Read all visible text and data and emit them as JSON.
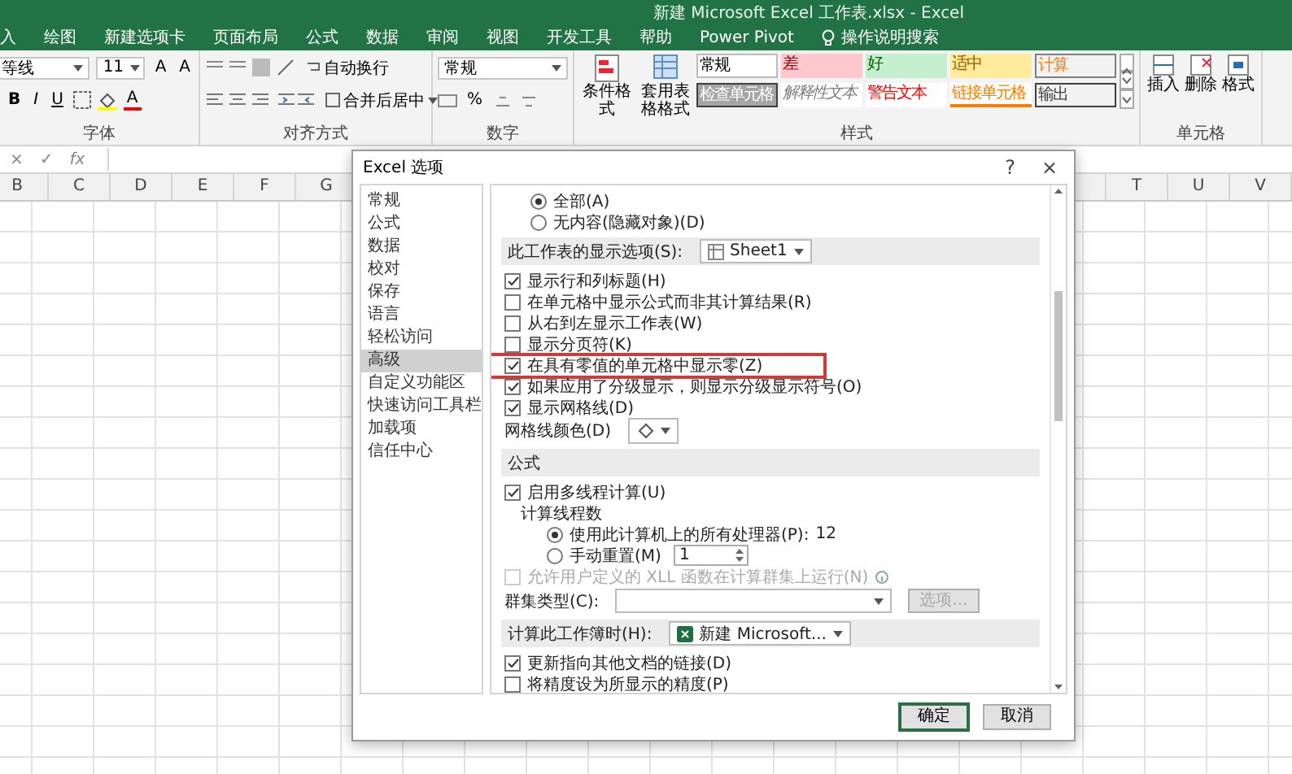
{
  "window": {
    "title": "新建 Microsoft Excel 工作表.xlsx  -  Excel"
  },
  "tabs": [
    {
      "label": "入"
    },
    {
      "label": "绘图"
    },
    {
      "label": "新建选项卡"
    },
    {
      "label": "页面布局"
    },
    {
      "label": "公式"
    },
    {
      "label": "数据"
    },
    {
      "label": "审阅"
    },
    {
      "label": "视图"
    },
    {
      "label": "开发工具"
    },
    {
      "label": "帮助"
    },
    {
      "label": "Power Pivot"
    }
  ],
  "tell_me": {
    "placeholder": "操作说明搜索"
  },
  "ribbon": {
    "font_group": {
      "label": "字体",
      "font": "等线",
      "size": "11",
      "size_buttons": [
        "A",
        "A"
      ],
      "format_buttons": [
        "B",
        "I",
        "U"
      ],
      "font_color_button": "A"
    },
    "alignment_group": {
      "label": "对齐方式",
      "wrap": "自动换行",
      "merge": "合并后居中"
    },
    "number_group": {
      "label": "数字",
      "format": "常规",
      "percent": "%"
    },
    "style_group": {
      "label": "样式",
      "conditional": "条件格式",
      "table": "套用表格格式",
      "styles": [
        {
          "label": "常规",
          "kind": "normal"
        },
        {
          "label": "差",
          "kind": "bad"
        },
        {
          "label": "好",
          "kind": "good"
        },
        {
          "label": "适中",
          "kind": "neutral"
        },
        {
          "label": "计算",
          "kind": "calculation"
        },
        {
          "label": "检查单元格",
          "kind": "check"
        },
        {
          "label": "解释性文本",
          "kind": "explanatory"
        },
        {
          "label": "警告文本",
          "kind": "warning"
        },
        {
          "label": "链接单元格",
          "kind": "linked"
        },
        {
          "label": "输出",
          "kind": "output"
        }
      ]
    },
    "cells_group": {
      "label": "单元格",
      "buttons": [
        "插入",
        "删除",
        "格式"
      ]
    }
  },
  "formula_bar": {
    "cancel": "×",
    "enter": "✓",
    "function": "fx"
  },
  "columns": [
    "B",
    "C",
    "D",
    "E",
    "F",
    "G",
    "T",
    "U",
    "V"
  ],
  "dialog": {
    "title": "Excel 选项",
    "help": "?",
    "close": "×",
    "sidebar": [
      {
        "label": "常规",
        "selected": false
      },
      {
        "label": "公式",
        "selected": false
      },
      {
        "label": "数据",
        "selected": false
      },
      {
        "label": "校对",
        "selected": false
      },
      {
        "label": "保存",
        "selected": false
      },
      {
        "label": "语言",
        "selected": false
      },
      {
        "label": "轻松访问",
        "selected": false
      },
      {
        "label": "高级",
        "selected": true
      },
      {
        "label": "自定义功能区",
        "selected": false
      },
      {
        "label": "快速访问工具栏",
        "selected": false
      },
      {
        "label": "加载项",
        "selected": false
      },
      {
        "label": "信任中心",
        "selected": false
      }
    ],
    "options": [
      {
        "kind": "radio",
        "label": "全部(A)",
        "selected": true
      },
      {
        "kind": "radio",
        "label": "无内容(隐藏对象)(D)",
        "selected": false
      },
      {
        "kind": "section",
        "label": "此工作表的显示选项(S):",
        "dropdown": "Sheet1"
      },
      {
        "kind": "checkbox",
        "label": "显示行和列标题(H)",
        "checked": true,
        "disabled": false
      },
      {
        "kind": "checkbox",
        "label": "在单元格中显示公式而非其计算结果(R)",
        "checked": false,
        "disabled": false
      },
      {
        "kind": "checkbox",
        "label": "从右到左显示工作表(W)",
        "checked": false,
        "disabled": false
      },
      {
        "kind": "checkbox",
        "label": "显示分页符(K)",
        "checked": false,
        "disabled": false
      },
      {
        "kind": "checkbox",
        "label": "在具有零值的单元格中显示零(Z)",
        "checked": true,
        "disabled": false,
        "highlighted": true
      },
      {
        "kind": "checkbox",
        "label": "如果应用了分级显示，则显示分级显示符号(O)",
        "checked": true,
        "disabled": false
      },
      {
        "kind": "checkbox",
        "label": "显示网格线(D)",
        "checked": true,
        "disabled": false
      },
      {
        "kind": "color",
        "label": "网格线颜色(D)"
      },
      {
        "kind": "section",
        "label": "公式"
      },
      {
        "kind": "checkbox",
        "label": "启用多线程计算(U)",
        "checked": true,
        "disabled": false
      },
      {
        "kind": "group",
        "label": "计算线程数",
        "children": [
          {
            "kind": "radio",
            "label": "使用此计算机上的所有处理器(P):",
            "selected": true,
            "reading": "12"
          },
          {
            "kind": "radio",
            "label": "手动重置(M)",
            "selected": false,
            "value": "1"
          }
        ]
      },
      {
        "kind": "checkbox",
        "label": "允许用户定义的 XLL 函数在计算群集上运行(N)",
        "checked": false,
        "disabled": true,
        "info": true
      },
      {
        "kind": "dropdown",
        "label": "群集类型(C):",
        "button": "选项..."
      },
      {
        "kind": "section",
        "label": "计算此工作簿时(H):",
        "dropdown": "新建 Microsoft..."
      },
      {
        "kind": "checkbox",
        "label": "更新指向其他文档的链接(D)",
        "checked": true,
        "disabled": false
      },
      {
        "kind": "checkbox",
        "label": "将精度设为所显示的精度(P)",
        "checked": false,
        "disabled": false
      }
    ],
    "buttons": [
      {
        "label": "确定",
        "kind": "default"
      },
      {
        "label": "取消",
        "kind": "normal"
      }
    ]
  }
}
